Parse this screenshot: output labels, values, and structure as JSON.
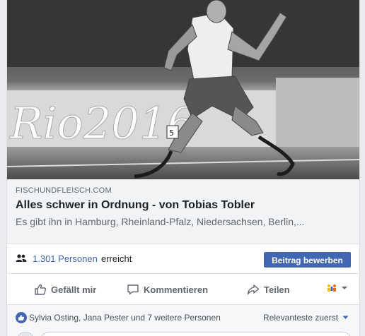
{
  "post": {
    "image": {
      "description_icon": "athlete-photo",
      "banner_text": "Rio2016",
      "bib_number": "5"
    },
    "link": {
      "domain": "FISCHUNDFLEISCH.COM",
      "title": "Alles schwer in Ordnung - von Tobias Tobler",
      "description": "Es gibt ihn in Hamburg, Rheinland-Pfalz, Niedersachsen, Berlin,..."
    },
    "reach": {
      "count_label": "1.301 Personen",
      "suffix": "erreicht",
      "boost_label": "Beitrag bewerben"
    },
    "actions": {
      "like": "Gefällt mir",
      "comment": "Kommentieren",
      "share": "Teilen"
    },
    "likes": {
      "names": "Sylvia Osting, Jana Pester und 7 weitere Personen",
      "sort_label": "Relevanteste zuerst"
    }
  },
  "colors": {
    "link_blue": "#4267b2",
    "secondary_text": "#606770",
    "border": "#dddfe2"
  }
}
